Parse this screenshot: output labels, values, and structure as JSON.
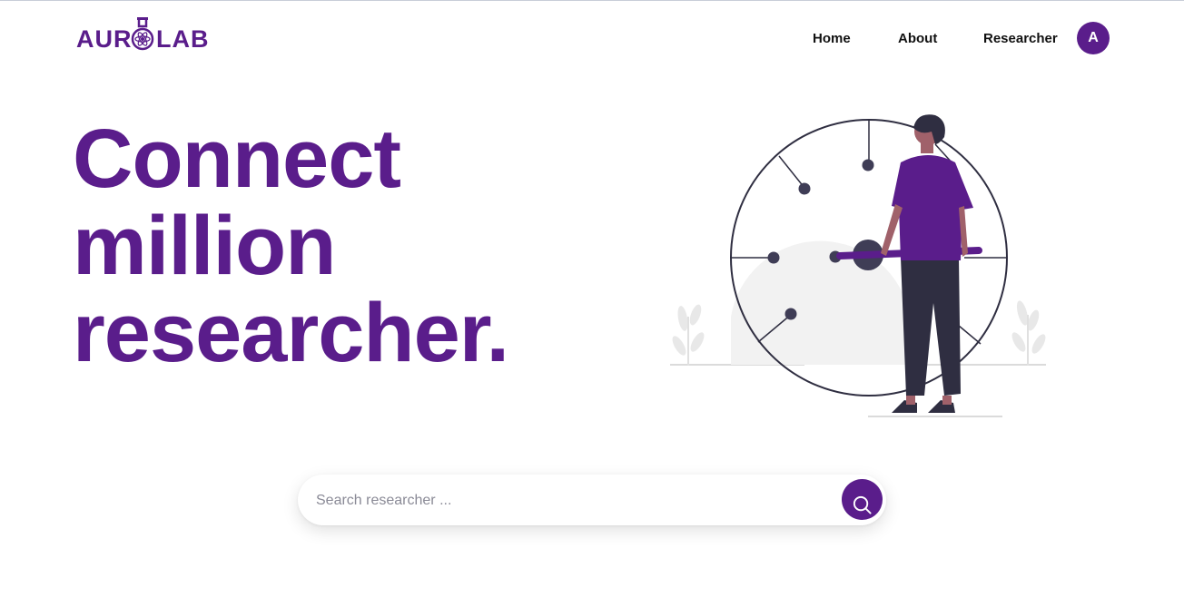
{
  "brand": {
    "name": "AURLAB",
    "logo_left": "AUR",
    "logo_right": "LAB",
    "logo_icon": "atom-flask-icon",
    "color": "#5a1d8b"
  },
  "nav": {
    "items": [
      {
        "label": "Home"
      },
      {
        "label": "About"
      },
      {
        "label": "Researcher"
      }
    ],
    "avatar_initial": "A"
  },
  "hero": {
    "lines": [
      "Connect",
      "million",
      "researcher."
    ],
    "illustration": "person-with-compass-dial-illustration"
  },
  "search": {
    "placeholder": "Search researcher ...",
    "value": "",
    "button_icon": "search-icon"
  },
  "colors": {
    "accent": "#5a1d8b",
    "text": "#111111",
    "dark": "#2f2e41",
    "light_gray": "#f2f2f2"
  }
}
